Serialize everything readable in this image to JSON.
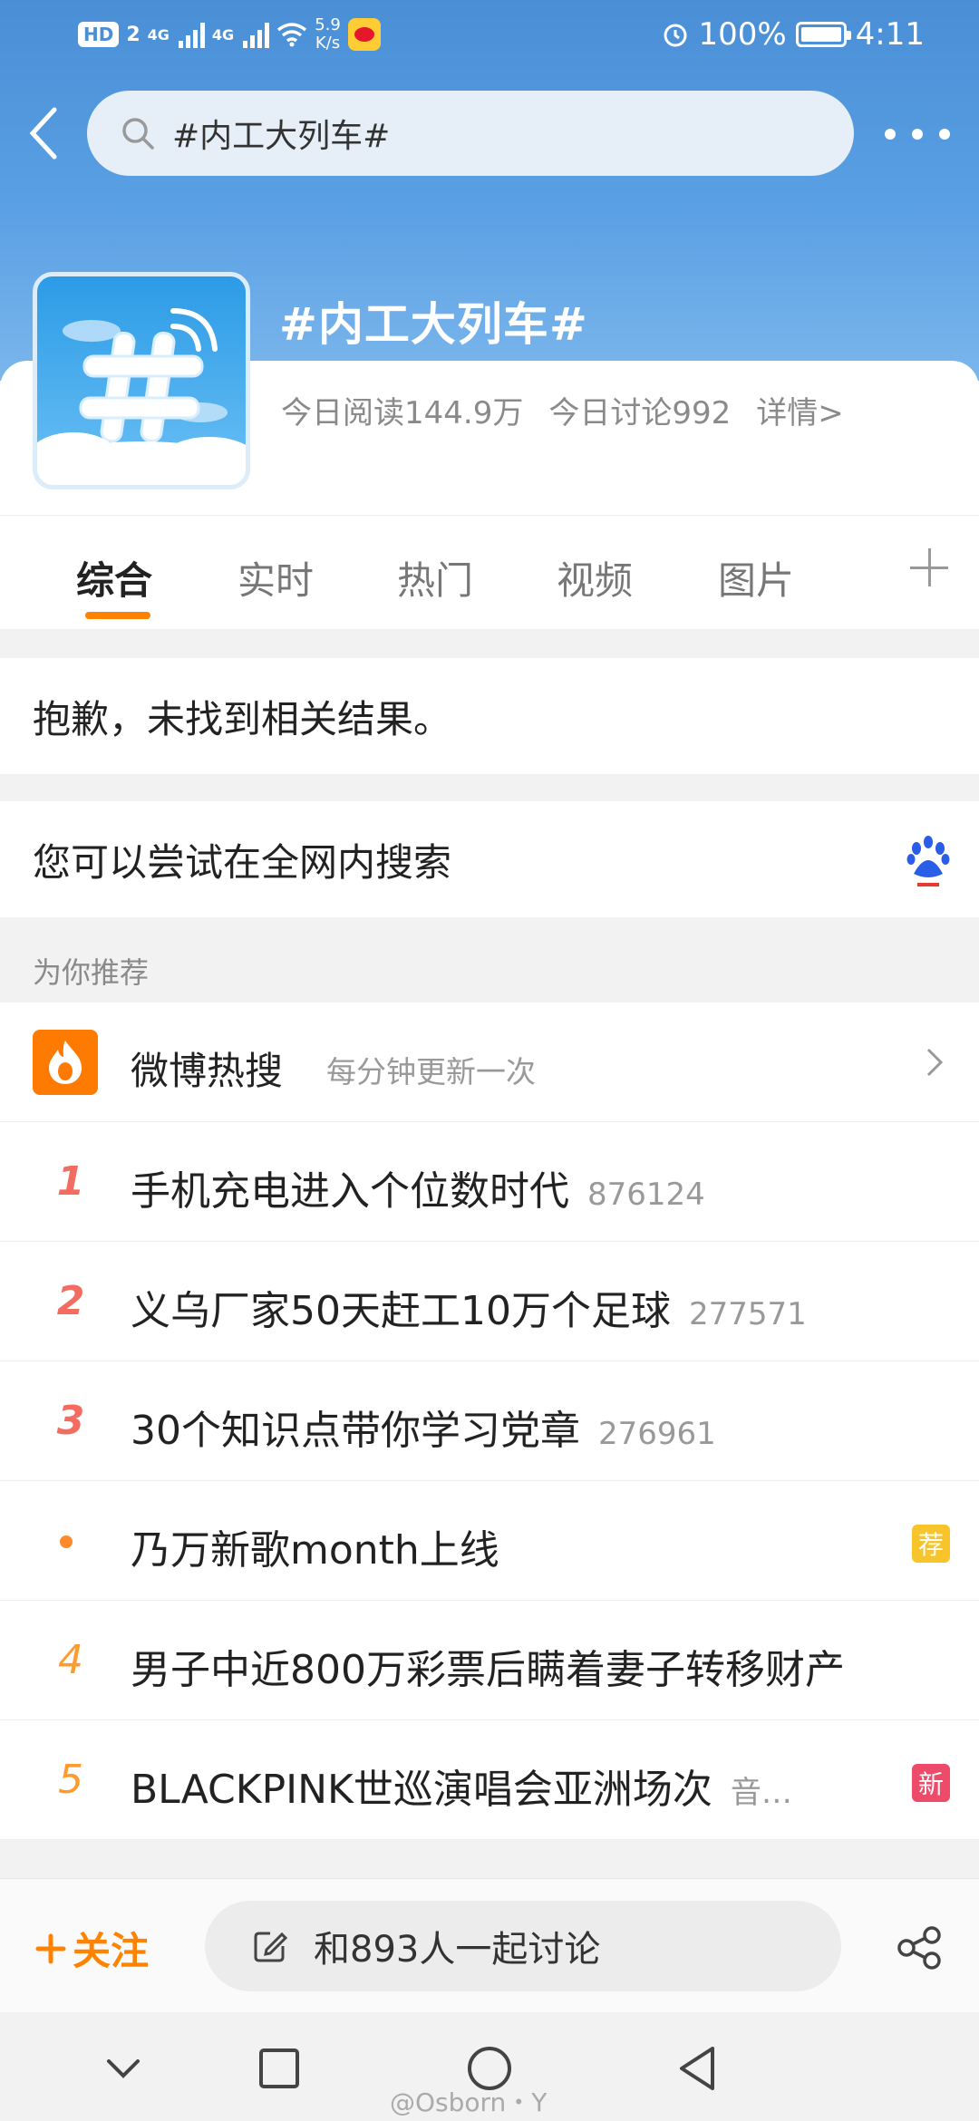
{
  "status_bar": {
    "hd_label": "HD",
    "sim_index": "2",
    "net1": "4G",
    "net2": "4G",
    "speed_value": "5.9",
    "speed_unit": "K/s",
    "battery": "100%",
    "time": "4:11"
  },
  "search": {
    "query": "#内工大列车#"
  },
  "topic": {
    "title": "#内工大列车#",
    "reads_today": "今日阅读144.9万",
    "discussions_today": "今日讨论992",
    "details_link": "详情>"
  },
  "tabs": [
    {
      "label": "综合",
      "active": true
    },
    {
      "label": "实时",
      "active": false
    },
    {
      "label": "热门",
      "active": false
    },
    {
      "label": "视频",
      "active": false
    },
    {
      "label": "图片",
      "active": false
    }
  ],
  "no_result_text": "抱歉，未找到相关结果。",
  "web_search_text": "您可以尝试在全网内搜索",
  "recommend_label": "为你推荐",
  "hot_search": {
    "title": "微博热搜",
    "subtitle": "每分钟更新一次",
    "items": [
      {
        "rank": "1",
        "title": "手机充电进入个位数时代",
        "count": "876124"
      },
      {
        "rank": "2",
        "title": "义乌厂家50天赶工10万个足球",
        "count": "277571"
      },
      {
        "rank": "3",
        "title": "30个知识点带你学习党章",
        "count": "276961"
      },
      {
        "rank": "",
        "title": "乃万新歌month上线",
        "count": "",
        "badge": "荐"
      },
      {
        "rank": "4",
        "title": "男子中近800万彩票后瞒着妻子转移财产",
        "count": ""
      },
      {
        "rank": "5",
        "title": "BLACKPINK世巡演唱会亚洲场次",
        "count": "音…",
        "badge": "新"
      }
    ]
  },
  "action_bar": {
    "follow_label": "关注",
    "discuss_label": "和893人一起讨论"
  },
  "watermark": "@Osborn・Y",
  "colors": {
    "header_blue": "#4a8fd6",
    "accent_orange": "#ff8200",
    "rank_red": "#f26d5f",
    "badge_yellow": "#f7c52b",
    "badge_pink": "#ee4a6a"
  }
}
